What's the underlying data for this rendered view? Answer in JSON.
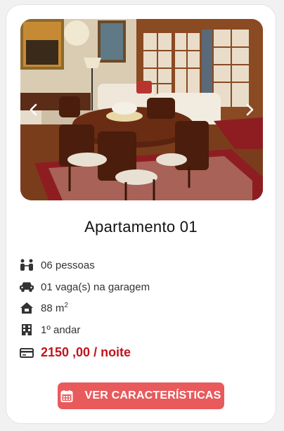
{
  "card": {
    "title": "Apartamento 01",
    "features": [
      {
        "icon": "people-icon",
        "text": "06 pessoas"
      },
      {
        "icon": "car-icon",
        "text": "01 vaga(s) na garagem"
      },
      {
        "icon": "house-area-icon",
        "text": "88 m",
        "sup": "2"
      },
      {
        "icon": "building-icon",
        "text": "1º andar"
      }
    ],
    "price": {
      "icon": "credit-card-icon",
      "text": "2150 ,00 / noite"
    },
    "button": {
      "icon": "calendar-icon",
      "label": "VER CARACTERÍSTICAS"
    }
  },
  "gallery": {
    "prev_icon": "chevron-left-icon",
    "next_icon": "chevron-right-icon"
  },
  "colors": {
    "accent": "#e85a5c",
    "price": "#c0141e",
    "icon": "#333333"
  }
}
